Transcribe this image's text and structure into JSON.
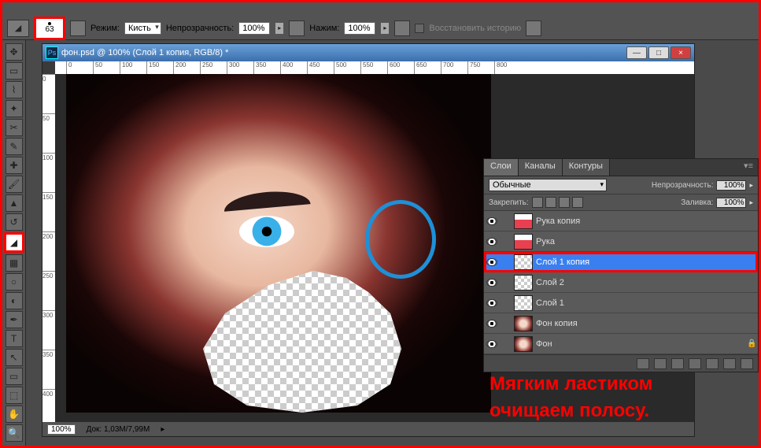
{
  "options_bar": {
    "brush_size": "63",
    "mode_label": "Режим:",
    "mode_value": "Кисть",
    "opacity_label": "Непрозрачность:",
    "opacity_value": "100%",
    "flow_label": "Нажим:",
    "flow_value": "100%",
    "restore_history_label": "Восстановить историю"
  },
  "document": {
    "title": "фон.psd @ 100% (Слой 1 копия, RGB/8) *",
    "zoom": "100%",
    "doc_size": "Док: 1,03M/7,99M",
    "ruler_ticks_h": [
      "0",
      "50",
      "100",
      "150",
      "200",
      "250",
      "300",
      "350",
      "400",
      "450",
      "500",
      "550",
      "600",
      "650",
      "700",
      "750",
      "800"
    ],
    "ruler_ticks_v": [
      "0",
      "50",
      "100",
      "150",
      "200",
      "250",
      "300",
      "350",
      "400"
    ]
  },
  "layers_panel": {
    "tabs": [
      "Слои",
      "Каналы",
      "Контуры"
    ],
    "blend_mode": "Обычные",
    "opacity_label": "Непрозрачность:",
    "opacity_value": "100%",
    "lock_label": "Закрепить:",
    "fill_label": "Заливка:",
    "fill_value": "100%",
    "layers": [
      {
        "name": "Рука копия",
        "thumb": "hand",
        "selected": false,
        "locked": false
      },
      {
        "name": "Рука",
        "thumb": "hand",
        "selected": false,
        "locked": false
      },
      {
        "name": "Слой 1 копия",
        "thumb": "checker",
        "selected": true,
        "locked": false
      },
      {
        "name": "Слой 2",
        "thumb": "checker",
        "selected": false,
        "locked": false
      },
      {
        "name": "Слой 1",
        "thumb": "checker",
        "selected": false,
        "locked": false
      },
      {
        "name": "Фон копия",
        "thumb": "face",
        "selected": false,
        "locked": false
      },
      {
        "name": "Фон",
        "thumb": "face",
        "selected": false,
        "locked": true
      }
    ]
  },
  "annotation": {
    "line1": "Мягким ластиком",
    "line2": "очищаем полосу."
  },
  "win_controls": {
    "min": "—",
    "max": "□",
    "close": "×"
  }
}
